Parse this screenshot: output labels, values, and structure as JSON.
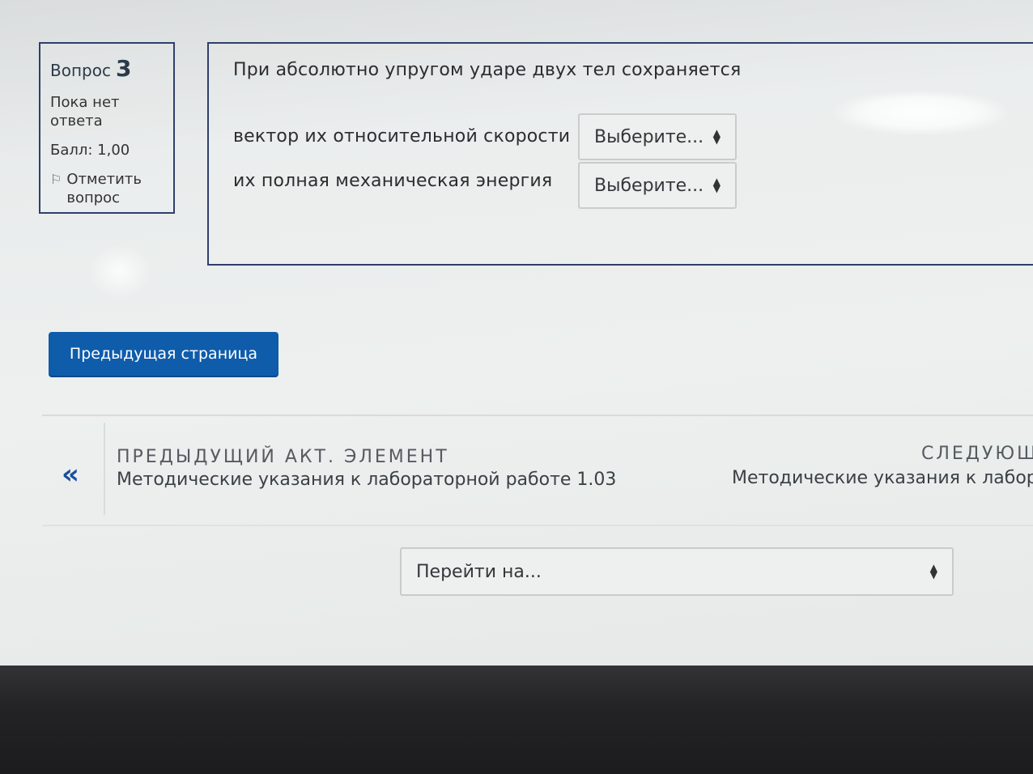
{
  "question_info": {
    "label": "Вопрос",
    "number": "3",
    "state": "Пока нет ответа",
    "grade": "Балл: 1,00",
    "flag_label": "Отметить вопрос"
  },
  "question": {
    "text": "При абсолютно упругом ударе двух тел сохраняется",
    "rows": [
      {
        "label": "вектор их относительной скорости",
        "select_value": "Выберите..."
      },
      {
        "label": "их полная механическая энергия",
        "select_value": "Выберите..."
      }
    ]
  },
  "buttons": {
    "previous_page": "Предыдущая страница"
  },
  "activity_nav": {
    "prev_arrow": "«",
    "prev_caption": "ПРЕДЫДУЩИЙ АКТ. ЭЛЕМЕНТ",
    "prev_title": "Методические указания к лабораторной работе 1.03",
    "next_caption": "СЛЕДУЮЩ",
    "next_title": "Методические указания к лабора"
  },
  "jump_select": {
    "value": "Перейти на..."
  },
  "icons": {
    "flag": "flag-icon",
    "select_arrows": "sort-arrows-icon",
    "prev": "double-chevron-left-icon"
  },
  "colors": {
    "primary_button": "#0f5cab",
    "border": "#2f3f6a",
    "nav_arrow": "#1a4f9c"
  }
}
